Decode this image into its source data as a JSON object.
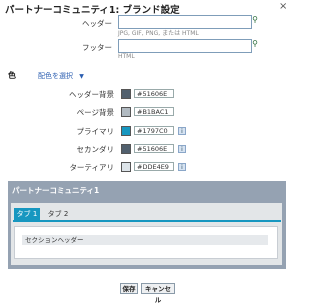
{
  "dialog": {
    "title": "パートナーコミュニティ1: ブランド設定",
    "close": "×"
  },
  "header_field": {
    "label": "ヘッダー",
    "value": "",
    "hint": "JPG, GIF, PNG, または HTML"
  },
  "footer_field": {
    "label": "フッター",
    "value": "",
    "hint": "HTML"
  },
  "colors": {
    "section_label": "色",
    "scheme_link": "配色を選択",
    "rows": [
      {
        "label": "ヘッダー背景",
        "hex": "#51606E",
        "swatch": "#51606e",
        "info": false
      },
      {
        "label": "ページ背景",
        "hex": "#B1BAC1",
        "swatch": "#b1bac1",
        "info": false
      },
      {
        "label": "プライマリ",
        "hex": "#1797C0",
        "swatch": "#1797c0",
        "info": true
      },
      {
        "label": "セカンダリ",
        "hex": "#51606E",
        "swatch": "#51606e",
        "info": true
      },
      {
        "label": "ターティアリ",
        "hex": "#DDE4E9",
        "swatch": "#dde4e9",
        "info": true
      }
    ]
  },
  "preview": {
    "title": "パートナーコミュニティ1",
    "tabs": [
      "タブ 1",
      "タブ 2"
    ],
    "section_header": "セクションヘッダー"
  },
  "buttons": {
    "save": "保存",
    "cancel": "キャンセル"
  }
}
